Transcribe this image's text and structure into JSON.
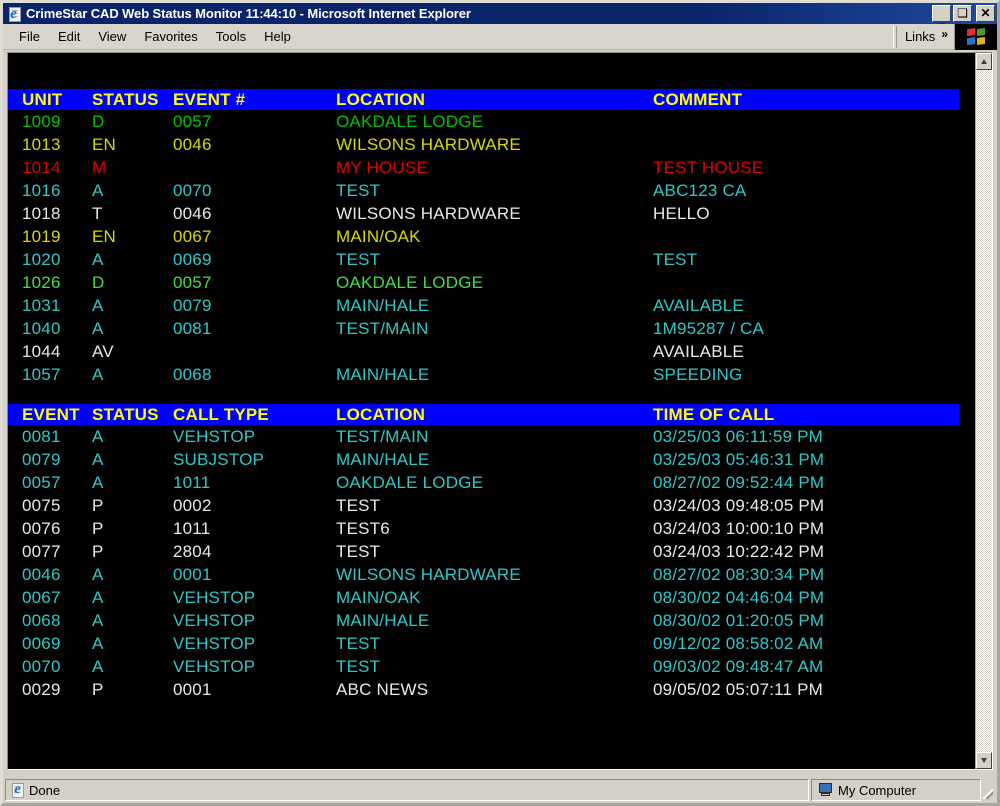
{
  "window": {
    "title": "CrimeStar CAD Web Status Monitor 11:44:10 - Microsoft Internet Explorer",
    "icon": "internet-explorer-icon",
    "minimize_label": "_",
    "maximize_label": "❑",
    "close_label": "✕"
  },
  "menubar": {
    "items": [
      {
        "label": "File"
      },
      {
        "label": "Edit"
      },
      {
        "label": "View"
      },
      {
        "label": "Favorites"
      },
      {
        "label": "Tools"
      },
      {
        "label": "Help"
      }
    ],
    "links_label": "Links",
    "links_chevron": "»",
    "logo_icon": "windows-flag-icon"
  },
  "colors": {
    "header_bg": "#0000FF",
    "header_text": "#FFFF00",
    "page_bg": "#000000",
    "status_green": "#00C000",
    "status_yellow": "#D8D800",
    "status_red": "#E00000",
    "status_teal": "#2EC8C8",
    "status_white": "#E8E8E8",
    "status_brightgreen": "#44DD44"
  },
  "units_table": {
    "columns": [
      "UNIT",
      "STATUS",
      "EVENT #",
      "LOCATION",
      "COMMENT"
    ],
    "rows": [
      {
        "unit": "1009",
        "status": "D",
        "event": "0057",
        "location": "OAKDALE LODGE",
        "comment": "",
        "color": "#00C000"
      },
      {
        "unit": "1013",
        "status": "EN",
        "event": "0046",
        "location": "WILSONS HARDWARE",
        "comment": "",
        "color": "#D8D800"
      },
      {
        "unit": "1014",
        "status": "M",
        "event": "",
        "location": "MY HOUSE",
        "comment": "TEST HOUSE",
        "color": "#E00000"
      },
      {
        "unit": "1016",
        "status": "A",
        "event": "0070",
        "location": "TEST",
        "comment": "ABC123 CA",
        "color": "#2EC8C8"
      },
      {
        "unit": "1018",
        "status": "T",
        "event": "0046",
        "location": "WILSONS HARDWARE",
        "comment": "HELLO",
        "color": "#E8E8E8"
      },
      {
        "unit": "1019",
        "status": "EN",
        "event": "0067",
        "location": "MAIN/OAK",
        "comment": "",
        "color": "#D8D800"
      },
      {
        "unit": "1020",
        "status": "A",
        "event": "0069",
        "location": "TEST",
        "comment": "TEST",
        "color": "#2EC8C8"
      },
      {
        "unit": "1026",
        "status": "D",
        "event": "0057",
        "location": "OAKDALE LODGE",
        "comment": "",
        "color": "#44DD44"
      },
      {
        "unit": "1031",
        "status": "A",
        "event": "0079",
        "location": "MAIN/HALE",
        "comment": "AVAILABLE",
        "color": "#2EC8C8"
      },
      {
        "unit": "1040",
        "status": "A",
        "event": "0081",
        "location": "TEST/MAIN",
        "comment": "1M95287 / CA",
        "color": "#2EC8C8"
      },
      {
        "unit": "1044",
        "status": "AV",
        "event": "",
        "location": "",
        "comment": "AVAILABLE",
        "color": "#E8E8E8"
      },
      {
        "unit": "1057",
        "status": "A",
        "event": "0068",
        "location": "MAIN/HALE",
        "comment": "SPEEDING",
        "color": "#2EC8C8"
      }
    ]
  },
  "events_table": {
    "columns": [
      "EVENT",
      "STATUS",
      "CALL TYPE",
      "LOCATION",
      "TIME OF CALL"
    ],
    "rows": [
      {
        "event": "0081",
        "status": "A",
        "call_type": "VEHSTOP",
        "location": "TEST/MAIN",
        "time": "03/25/03 06:11:59 PM",
        "color": "#2EC8C8"
      },
      {
        "event": "0079",
        "status": "A",
        "call_type": "SUBJSTOP",
        "location": "MAIN/HALE",
        "time": "03/25/03 05:46:31 PM",
        "color": "#2EC8C8"
      },
      {
        "event": "0057",
        "status": "A",
        "call_type": "1011",
        "location": "OAKDALE LODGE",
        "time": "08/27/02 09:52:44 PM",
        "color": "#2EC8C8"
      },
      {
        "event": "0075",
        "status": "P",
        "call_type": "0002",
        "location": "TEST",
        "time": "03/24/03 09:48:05 PM",
        "color": "#E8E8E8"
      },
      {
        "event": "0076",
        "status": "P",
        "call_type": "1011",
        "location": "TEST6",
        "time": "03/24/03 10:00:10 PM",
        "color": "#E8E8E8"
      },
      {
        "event": "0077",
        "status": "P",
        "call_type": "2804",
        "location": "TEST",
        "time": "03/24/03 10:22:42 PM",
        "color": "#E8E8E8"
      },
      {
        "event": "0046",
        "status": "A",
        "call_type": "0001",
        "location": "WILSONS HARDWARE",
        "time": "08/27/02 08:30:34 PM",
        "color": "#2EC8C8"
      },
      {
        "event": "0067",
        "status": "A",
        "call_type": "VEHSTOP",
        "location": "MAIN/OAK",
        "time": "08/30/02 04:46:04 PM",
        "color": "#2EC8C8"
      },
      {
        "event": "0068",
        "status": "A",
        "call_type": "VEHSTOP",
        "location": "MAIN/HALE",
        "time": "08/30/02 01:20:05 PM",
        "color": "#2EC8C8"
      },
      {
        "event": "0069",
        "status": "A",
        "call_type": "VEHSTOP",
        "location": "TEST",
        "time": "09/12/02 08:58:02 AM",
        "color": "#2EC8C8"
      },
      {
        "event": "0070",
        "status": "A",
        "call_type": "VEHSTOP",
        "location": "TEST",
        "time": "09/03/02 09:48:47 AM",
        "color": "#2EC8C8"
      },
      {
        "event": "0029",
        "status": "P",
        "call_type": "0001",
        "location": "ABC NEWS",
        "time": "09/05/02 05:07:11 PM",
        "color": "#E8E8E8"
      }
    ]
  },
  "statusbar": {
    "message": "Done",
    "message_icon": "internet-explorer-icon",
    "zone": "My Computer",
    "zone_icon": "my-computer-icon"
  },
  "scrollbar": {
    "up_icon": "scroll-up-arrow-icon",
    "down_icon": "scroll-down-arrow-icon"
  }
}
